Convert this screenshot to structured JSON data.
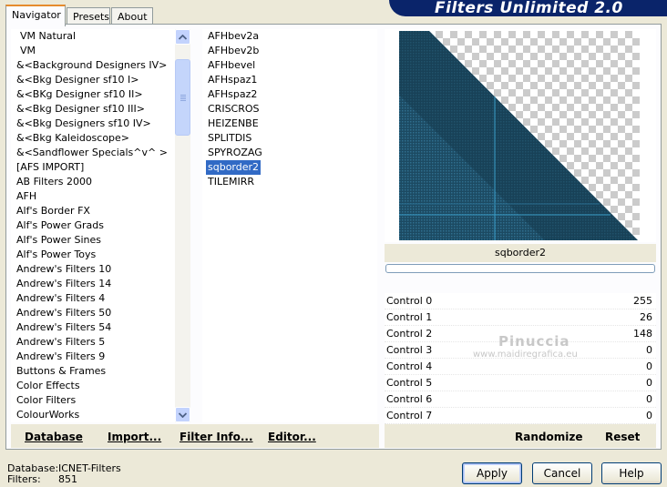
{
  "tabs": [
    "Navigator",
    "Presets",
    "About"
  ],
  "banner_title": "Filters Unlimited 2.0",
  "categories": [
    "VM Natural",
    "VM",
    "&<Background Designers IV>",
    "&<Bkg Designer sf10 I>",
    "&<BKg Designer sf10 II>",
    "&<Bkg Designer sf10 III>",
    "&<Bkg Designers sf10 IV>",
    "&<Bkg Kaleidoscope>",
    "&<Sandflower Specials^v^ >",
    "[AFS IMPORT]",
    "AB Filters 2000",
    "AFH",
    "Alf's Border FX",
    "Alf's Power Grads",
    "Alf's Power Sines",
    "Alf's Power Toys",
    "Andrew's Filters 10",
    "Andrew's Filters 14",
    "Andrew's Filters 4",
    "Andrew's Filters 50",
    "Andrew's Filters 54",
    "Andrew's Filters 5",
    "Andrew's Filters 9",
    "Buttons & Frames",
    "Color Effects",
    "Color Filters",
    "ColourWorks"
  ],
  "filters": [
    "AFHbev2a",
    "AFHbev2b",
    "AFHbevel",
    "AFHspaz1",
    "AFHspaz2",
    "CRISCROS",
    "HEIZENBE",
    "SPLITDIS",
    "SPYROZAG",
    "sqborder2",
    "TILEMIRR"
  ],
  "selected_filter": "sqborder2",
  "left_buttons": {
    "database": "Database",
    "import": "Import...",
    "filter_info": "Filter Info...",
    "editor": "Editor..."
  },
  "filter_name": "sqborder2",
  "controls": [
    {
      "label": "Control 0",
      "value": "255"
    },
    {
      "label": "Control 1",
      "value": "26"
    },
    {
      "label": "Control 2",
      "value": "148"
    },
    {
      "label": "Control 3",
      "value": "0"
    },
    {
      "label": "Control 4",
      "value": "0"
    },
    {
      "label": "Control 5",
      "value": "0"
    },
    {
      "label": "Control 6",
      "value": "0"
    },
    {
      "label": "Control 7",
      "value": "0"
    }
  ],
  "watermark": {
    "name": "Pinuccia",
    "url": "www.maidiregrafica.eu"
  },
  "right_buttons": {
    "randomize": "Randomize",
    "reset": "Reset"
  },
  "status": {
    "database_label": "Database:",
    "database_value": "ICNET-Filters",
    "filters_label": "Filters:",
    "filters_value": "851"
  },
  "dialog_buttons": {
    "apply": "Apply",
    "cancel": "Cancel",
    "help": "Help"
  },
  "colors": {
    "selection": "#316ac5",
    "banner": "#0a246a",
    "preview_fill": "#1e4a63"
  }
}
